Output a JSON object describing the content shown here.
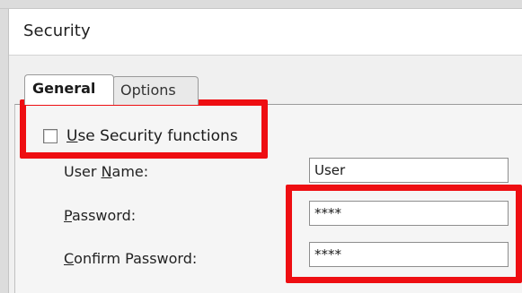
{
  "window": {
    "title": "Security"
  },
  "tabs": [
    {
      "label": "General",
      "selected": true
    },
    {
      "label": "Options",
      "selected": false
    }
  ],
  "use_security": {
    "label_prefix": "",
    "label_key": "U",
    "label_rest": "se Security functions",
    "checked": false
  },
  "fields": {
    "user_name": {
      "label_pre": "User ",
      "label_key": "N",
      "label_post": "ame:",
      "value": "User"
    },
    "password": {
      "label_pre": "",
      "label_key": "P",
      "label_post": "assword:",
      "value": "****"
    },
    "confirm_password": {
      "label_pre": "",
      "label_key": "C",
      "label_post": "onfirm Password:",
      "value": "****"
    }
  },
  "colors": {
    "highlight": "#ee0e12"
  }
}
